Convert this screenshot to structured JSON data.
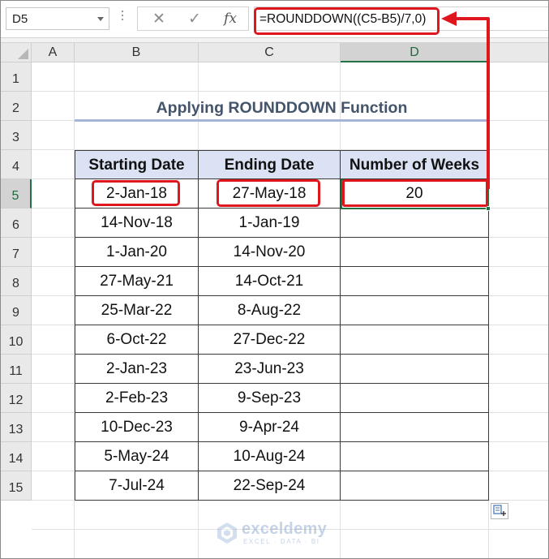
{
  "formula_bar": {
    "name_box": "D5",
    "cancel_icon": "✕",
    "enter_icon": "✓",
    "fx_label": "fx",
    "formula": "=ROUNDDOWN((C5-B5)/7,0)"
  },
  "columns": [
    "A",
    "B",
    "C",
    "D"
  ],
  "selected_column": "D",
  "rows": [
    "1",
    "2",
    "3",
    "4",
    "5",
    "6",
    "7",
    "8",
    "9",
    "10",
    "11",
    "12",
    "13",
    "14",
    "15"
  ],
  "selected_row": "5",
  "sheet": {
    "title": "Applying ROUNDDOWN Function",
    "headers": [
      "Starting Date",
      "Ending Date",
      "Number of Weeks"
    ],
    "data": [
      [
        "2-Jan-18",
        "27-May-18",
        "20"
      ],
      [
        "14-Nov-18",
        "1-Jan-19",
        ""
      ],
      [
        "1-Jan-20",
        "14-Nov-20",
        ""
      ],
      [
        "27-May-21",
        "14-Oct-21",
        ""
      ],
      [
        "25-Mar-22",
        "8-Aug-22",
        ""
      ],
      [
        "6-Oct-22",
        "27-Dec-22",
        ""
      ],
      [
        "2-Jan-23",
        "23-Jun-23",
        ""
      ],
      [
        "2-Feb-23",
        "9-Sep-23",
        ""
      ],
      [
        "10-Dec-23",
        "9-Apr-24",
        ""
      ],
      [
        "5-May-24",
        "10-Aug-24",
        ""
      ],
      [
        "7-Jul-24",
        "22-Sep-24",
        ""
      ]
    ]
  },
  "watermark": {
    "name": "exceldemy",
    "tagline": "EXCEL · DATA · BI"
  },
  "colors": {
    "accent_green": "#217346",
    "highlight_red": "#e0161e",
    "header_fill": "#dbe2f3",
    "title_color": "#44546a"
  }
}
